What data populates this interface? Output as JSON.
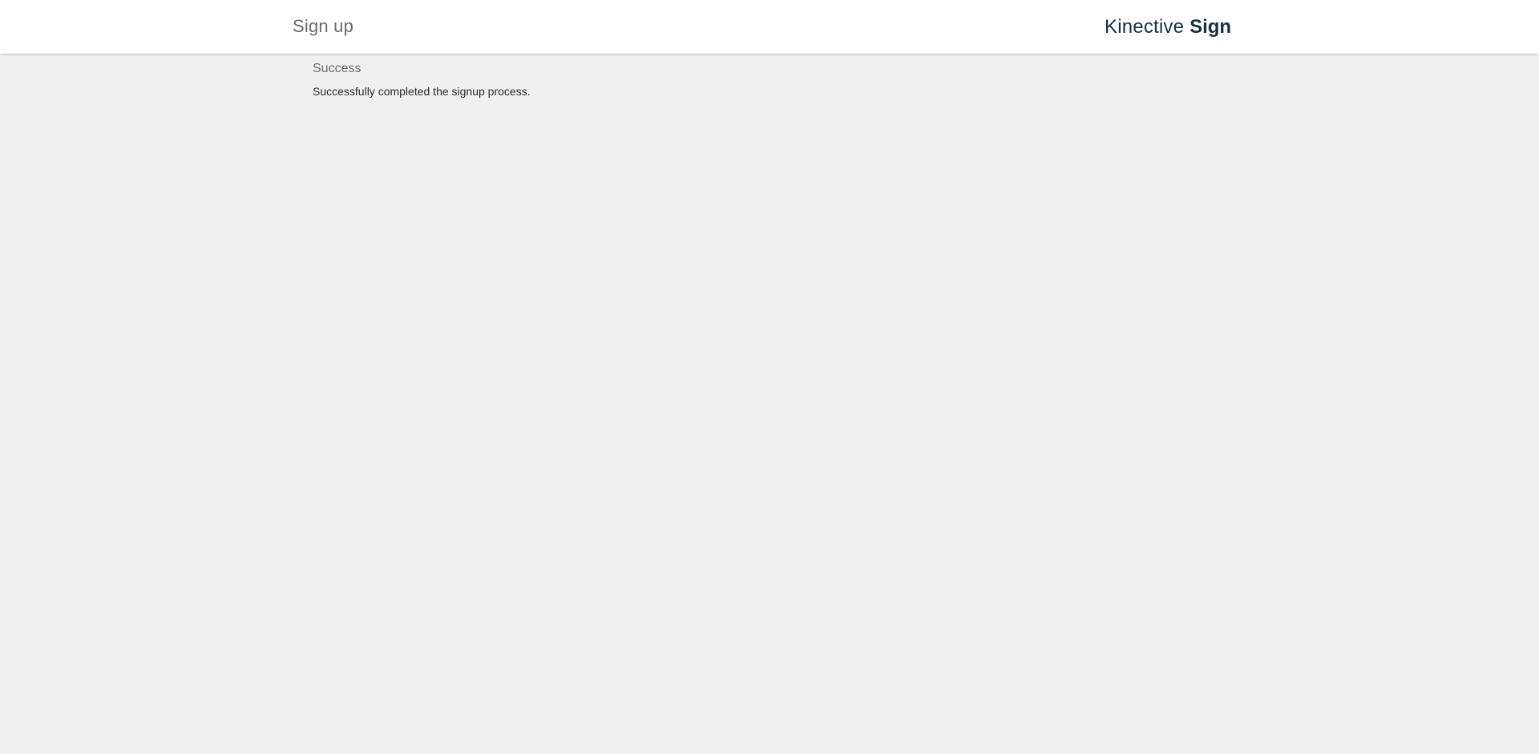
{
  "header": {
    "title": "Sign up",
    "brand": {
      "light": "Kinective",
      "bold": "Sign",
      "color": "#17323f"
    }
  },
  "main": {
    "section_title": "Success",
    "message": "Successfully completed the signup process."
  },
  "colors": {
    "background": "#f0f0f0",
    "header_background": "#ffffff"
  }
}
